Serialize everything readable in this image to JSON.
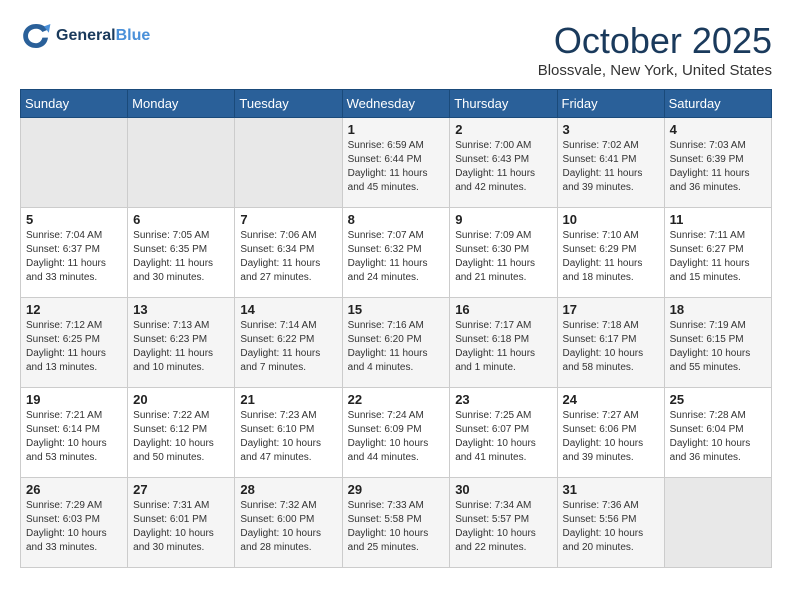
{
  "header": {
    "logo_line1": "General",
    "logo_line2": "Blue",
    "month": "October 2025",
    "location": "Blossvale, New York, United States"
  },
  "days_of_week": [
    "Sunday",
    "Monday",
    "Tuesday",
    "Wednesday",
    "Thursday",
    "Friday",
    "Saturday"
  ],
  "weeks": [
    [
      {
        "day": "",
        "info": ""
      },
      {
        "day": "",
        "info": ""
      },
      {
        "day": "",
        "info": ""
      },
      {
        "day": "1",
        "info": "Sunrise: 6:59 AM\nSunset: 6:44 PM\nDaylight: 11 hours\nand 45 minutes."
      },
      {
        "day": "2",
        "info": "Sunrise: 7:00 AM\nSunset: 6:43 PM\nDaylight: 11 hours\nand 42 minutes."
      },
      {
        "day": "3",
        "info": "Sunrise: 7:02 AM\nSunset: 6:41 PM\nDaylight: 11 hours\nand 39 minutes."
      },
      {
        "day": "4",
        "info": "Sunrise: 7:03 AM\nSunset: 6:39 PM\nDaylight: 11 hours\nand 36 minutes."
      }
    ],
    [
      {
        "day": "5",
        "info": "Sunrise: 7:04 AM\nSunset: 6:37 PM\nDaylight: 11 hours\nand 33 minutes."
      },
      {
        "day": "6",
        "info": "Sunrise: 7:05 AM\nSunset: 6:35 PM\nDaylight: 11 hours\nand 30 minutes."
      },
      {
        "day": "7",
        "info": "Sunrise: 7:06 AM\nSunset: 6:34 PM\nDaylight: 11 hours\nand 27 minutes."
      },
      {
        "day": "8",
        "info": "Sunrise: 7:07 AM\nSunset: 6:32 PM\nDaylight: 11 hours\nand 24 minutes."
      },
      {
        "day": "9",
        "info": "Sunrise: 7:09 AM\nSunset: 6:30 PM\nDaylight: 11 hours\nand 21 minutes."
      },
      {
        "day": "10",
        "info": "Sunrise: 7:10 AM\nSunset: 6:29 PM\nDaylight: 11 hours\nand 18 minutes."
      },
      {
        "day": "11",
        "info": "Sunrise: 7:11 AM\nSunset: 6:27 PM\nDaylight: 11 hours\nand 15 minutes."
      }
    ],
    [
      {
        "day": "12",
        "info": "Sunrise: 7:12 AM\nSunset: 6:25 PM\nDaylight: 11 hours\nand 13 minutes."
      },
      {
        "day": "13",
        "info": "Sunrise: 7:13 AM\nSunset: 6:23 PM\nDaylight: 11 hours\nand 10 minutes."
      },
      {
        "day": "14",
        "info": "Sunrise: 7:14 AM\nSunset: 6:22 PM\nDaylight: 11 hours\nand 7 minutes."
      },
      {
        "day": "15",
        "info": "Sunrise: 7:16 AM\nSunset: 6:20 PM\nDaylight: 11 hours\nand 4 minutes."
      },
      {
        "day": "16",
        "info": "Sunrise: 7:17 AM\nSunset: 6:18 PM\nDaylight: 11 hours\nand 1 minute."
      },
      {
        "day": "17",
        "info": "Sunrise: 7:18 AM\nSunset: 6:17 PM\nDaylight: 10 hours\nand 58 minutes."
      },
      {
        "day": "18",
        "info": "Sunrise: 7:19 AM\nSunset: 6:15 PM\nDaylight: 10 hours\nand 55 minutes."
      }
    ],
    [
      {
        "day": "19",
        "info": "Sunrise: 7:21 AM\nSunset: 6:14 PM\nDaylight: 10 hours\nand 53 minutes."
      },
      {
        "day": "20",
        "info": "Sunrise: 7:22 AM\nSunset: 6:12 PM\nDaylight: 10 hours\nand 50 minutes."
      },
      {
        "day": "21",
        "info": "Sunrise: 7:23 AM\nSunset: 6:10 PM\nDaylight: 10 hours\nand 47 minutes."
      },
      {
        "day": "22",
        "info": "Sunrise: 7:24 AM\nSunset: 6:09 PM\nDaylight: 10 hours\nand 44 minutes."
      },
      {
        "day": "23",
        "info": "Sunrise: 7:25 AM\nSunset: 6:07 PM\nDaylight: 10 hours\nand 41 minutes."
      },
      {
        "day": "24",
        "info": "Sunrise: 7:27 AM\nSunset: 6:06 PM\nDaylight: 10 hours\nand 39 minutes."
      },
      {
        "day": "25",
        "info": "Sunrise: 7:28 AM\nSunset: 6:04 PM\nDaylight: 10 hours\nand 36 minutes."
      }
    ],
    [
      {
        "day": "26",
        "info": "Sunrise: 7:29 AM\nSunset: 6:03 PM\nDaylight: 10 hours\nand 33 minutes."
      },
      {
        "day": "27",
        "info": "Sunrise: 7:31 AM\nSunset: 6:01 PM\nDaylight: 10 hours\nand 30 minutes."
      },
      {
        "day": "28",
        "info": "Sunrise: 7:32 AM\nSunset: 6:00 PM\nDaylight: 10 hours\nand 28 minutes."
      },
      {
        "day": "29",
        "info": "Sunrise: 7:33 AM\nSunset: 5:58 PM\nDaylight: 10 hours\nand 25 minutes."
      },
      {
        "day": "30",
        "info": "Sunrise: 7:34 AM\nSunset: 5:57 PM\nDaylight: 10 hours\nand 22 minutes."
      },
      {
        "day": "31",
        "info": "Sunrise: 7:36 AM\nSunset: 5:56 PM\nDaylight: 10 hours\nand 20 minutes."
      },
      {
        "day": "",
        "info": ""
      }
    ]
  ]
}
